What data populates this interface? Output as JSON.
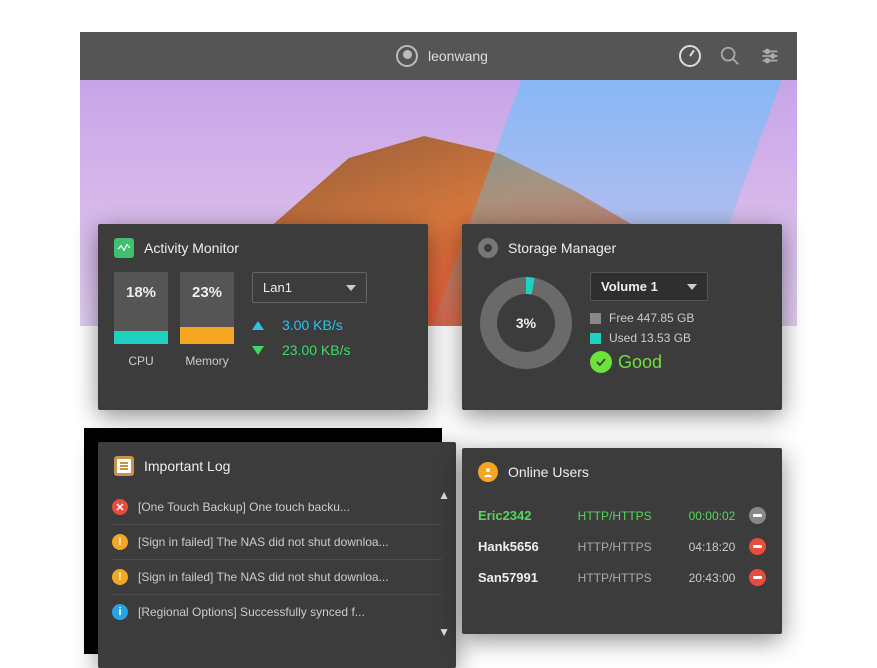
{
  "topbar": {
    "username": "leonwang"
  },
  "activity": {
    "title": "Activity Monitor",
    "cpu_pct": "18%",
    "cpu_label": "CPU",
    "mem_pct": "23%",
    "mem_label": "Memory",
    "lan_selected": "Lan1",
    "upload": "3.00 KB/s",
    "download": "23.00 KB/s"
  },
  "storage": {
    "title": "Storage Manager",
    "donut_pct": "3%",
    "volume_selected": "Volume 1",
    "free_label": "Free 447.85 GB",
    "used_label": "Used 13.53 GB",
    "status": "Good"
  },
  "log": {
    "title": "Important Log",
    "items": [
      {
        "type": "err",
        "text": "[One Touch Backup] One touch backu..."
      },
      {
        "type": "warn",
        "text": "[Sign in failed] The NAS did not shut downloa..."
      },
      {
        "type": "warn",
        "text": "[Sign in failed] The NAS did not shut downloa..."
      },
      {
        "type": "info",
        "text": "[Regional Options] Successfully synced f..."
      }
    ]
  },
  "users": {
    "title": "Online Users",
    "rows": [
      {
        "name": "Eric2342",
        "proto": "HTTP/HTTPS",
        "time": "00:00:02",
        "active": true,
        "kick": "g"
      },
      {
        "name": "Hank5656",
        "proto": "HTTP/HTTPS",
        "time": "04:18:20",
        "active": false,
        "kick": "r"
      },
      {
        "name": "San57991",
        "proto": "HTTP/HTTPS",
        "time": "20:43:00",
        "active": false,
        "kick": "r"
      }
    ]
  }
}
